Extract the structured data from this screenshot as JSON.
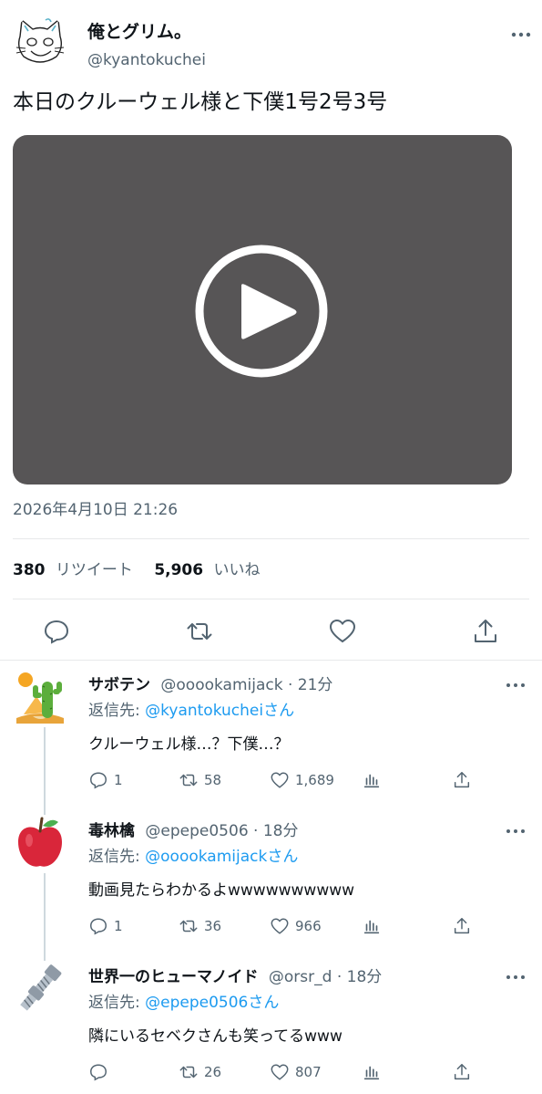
{
  "tweet": {
    "author_name": "俺とグリム。",
    "author_handle": "@kyantokuchei",
    "text": "本日のクルーウェル様と下僕1号2号3号",
    "timestamp": "2026年4月10日 21:26",
    "retweets_count": "380",
    "retweets_label": "リツイート",
    "likes_count": "5,906",
    "likes_label": "いいね"
  },
  "icons": {
    "more": "more-horizontal-icon",
    "reply": "reply-icon",
    "retweet": "retweet-icon",
    "like": "heart-icon",
    "share": "share-icon",
    "views": "analytics-icon",
    "play": "play-icon"
  },
  "colors": {
    "link": "#1d9bf0",
    "secondary_text": "#536471",
    "video_bg": "#575556",
    "divider": "#e7e9ea"
  },
  "replies": [
    {
      "name": "サボテン",
      "meta": "@ooookamijack · 21分",
      "reply_to_prefix": "返信先: ",
      "reply_to": "@kyantokucheiさん",
      "text": "クルーウェル様…？下僕…？",
      "reply_count": "1",
      "retweet_count": "58",
      "like_count": "1,689"
    },
    {
      "name": "毒林檎",
      "meta": "@epepe0506 · 18分",
      "reply_to_prefix": "返信先: ",
      "reply_to": "@ooookamijackさん",
      "text": "動画見たらわかるよwwwwwwwwww",
      "reply_count": "1",
      "retweet_count": "36",
      "like_count": "966"
    },
    {
      "name": "世界一のヒューマノイド",
      "meta": "@orsr_d · 18分",
      "reply_to_prefix": "返信先: ",
      "reply_to": "@epepe0506さん",
      "text": "隣にいるセベクさんも笑ってるwww",
      "reply_count": "",
      "retweet_count": "26",
      "like_count": "807"
    }
  ]
}
